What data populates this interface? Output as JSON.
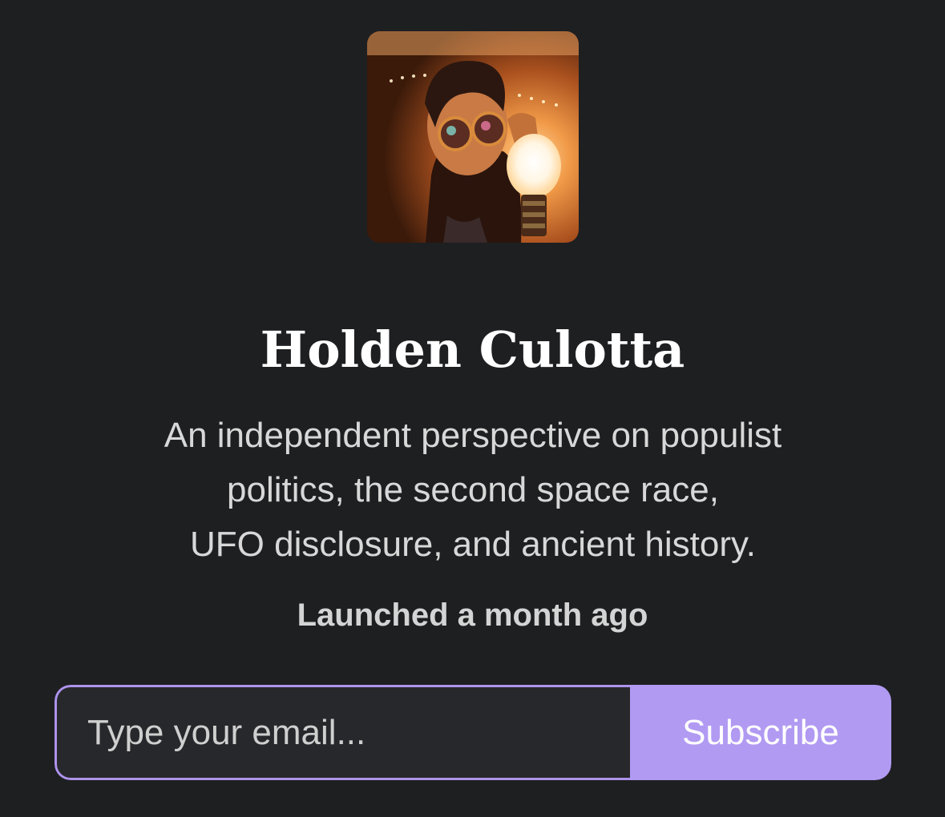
{
  "profile": {
    "avatar_alt": "profile photo",
    "name": "Holden Culotta",
    "description_lines": [
      "An independent perspective on populist",
      "politics, the second space race,",
      "UFO disclosure, and ancient history."
    ],
    "launched": "Launched a month ago"
  },
  "subscribe_form": {
    "email_placeholder": "Type your email...",
    "button_label": "Subscribe"
  },
  "colors": {
    "background": "#1e1f21",
    "accent": "#b19af2",
    "input_border": "#ad93ec"
  }
}
